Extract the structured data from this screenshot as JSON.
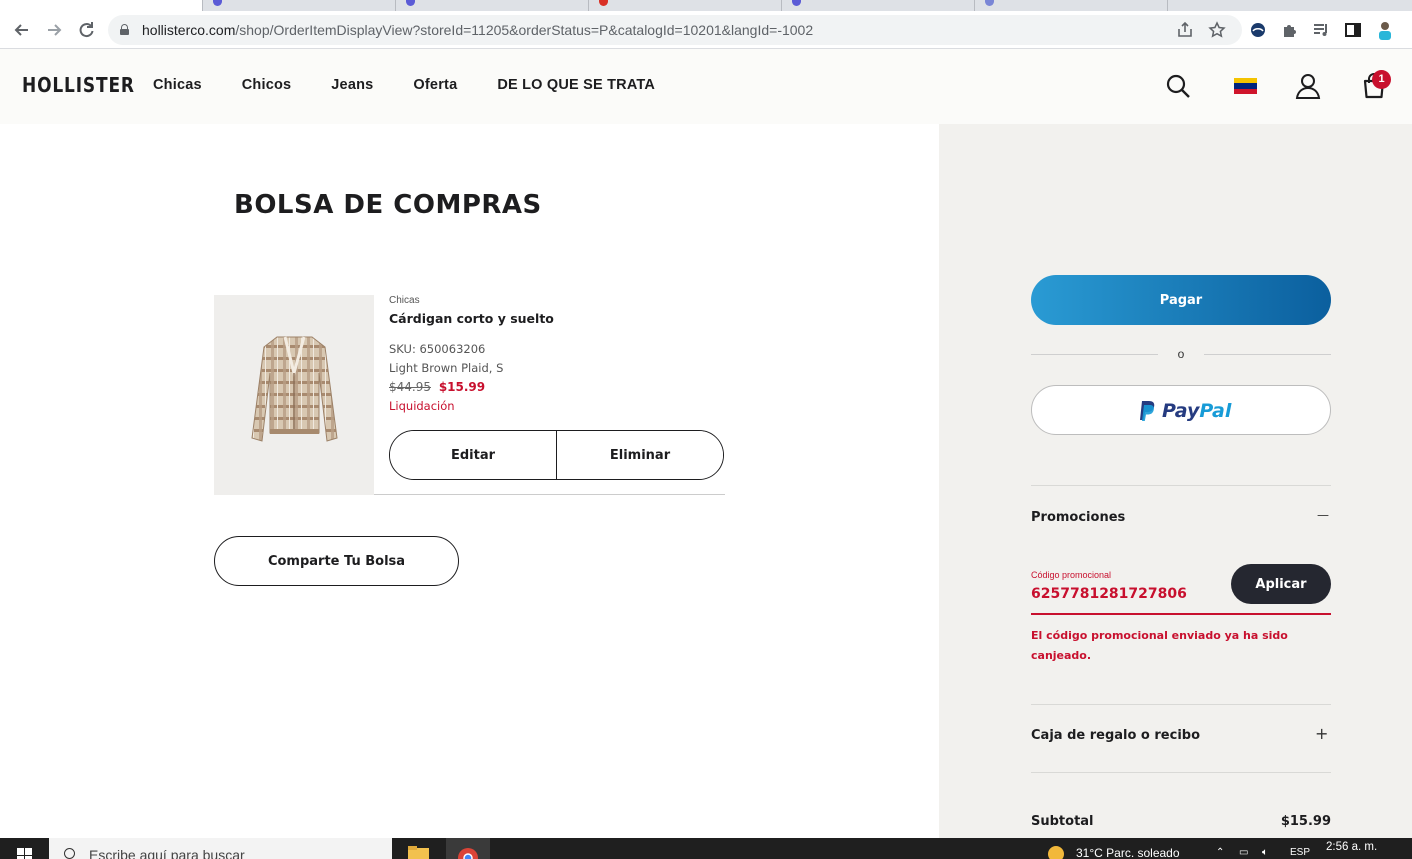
{
  "browser": {
    "tab_colors": [
      "#ffffff",
      "#5b5bd6",
      "#5b5bd6",
      "#d93025",
      "#5b5bd6",
      "#7a86d6"
    ],
    "url_host": "hollisterco.com",
    "url_path": "/shop/OrderItemDisplayView?storeId=11205&orderStatus=P&catalogId=10201&langId=-1002",
    "icons": [
      "back-icon",
      "forward-icon",
      "reload-icon",
      "lock-icon",
      "share-icon",
      "star-icon",
      "extension-icon",
      "puzzle-icon",
      "media-icon",
      "sidepanel-icon",
      "profile-icon"
    ]
  },
  "header": {
    "logo": "HOLLISTER",
    "nav": [
      "Chicas",
      "Chicos",
      "Jeans",
      "Oferta",
      "DE LO QUE SE TRATA"
    ],
    "bag_count": "1",
    "flag_colors": [
      "#f4c300",
      "#00247d",
      "#cf142b"
    ]
  },
  "cart": {
    "title": "BOLSA DE COMPRAS",
    "item": {
      "category": "Chicas",
      "name": "Cárdigan corto y suelto",
      "sku": "SKU: 650063206",
      "variant": "Light Brown Plaid, S",
      "old_price": "$44.95",
      "price": "$15.99",
      "sale_label": "Liquidación",
      "edit_label": "Editar",
      "remove_label": "Eliminar"
    },
    "share_label": "Comparte Tu Bolsa"
  },
  "summary": {
    "checkout_label": "Pagar",
    "or_label": "o",
    "paypal_pay": "Pay",
    "paypal_pal": "Pal",
    "promotions_title": "Promociones",
    "promotions_toggle": "—",
    "promo_label": "Código promocional",
    "promo_value": "6257781281727806",
    "apply_label": "Aplicar",
    "promo_error": "El código promocional enviado ya ha sido canjeado.",
    "gift_title": "Caja de regalo o recibo",
    "gift_toggle": "+",
    "subtotal_label": "Subtotal",
    "subtotal_value": "$15.99"
  },
  "taskbar": {
    "search_placeholder": "Escribe aquí para buscar",
    "weather": "31°C  Parc. soleado",
    "lang": "ESP",
    "time": "2:56 a. m."
  },
  "colors": {
    "accent_red": "#c8102e",
    "checkout_gradient_start": "#2a9bd4",
    "checkout_gradient_end": "#0b5f9e",
    "dark_button": "#252730"
  }
}
